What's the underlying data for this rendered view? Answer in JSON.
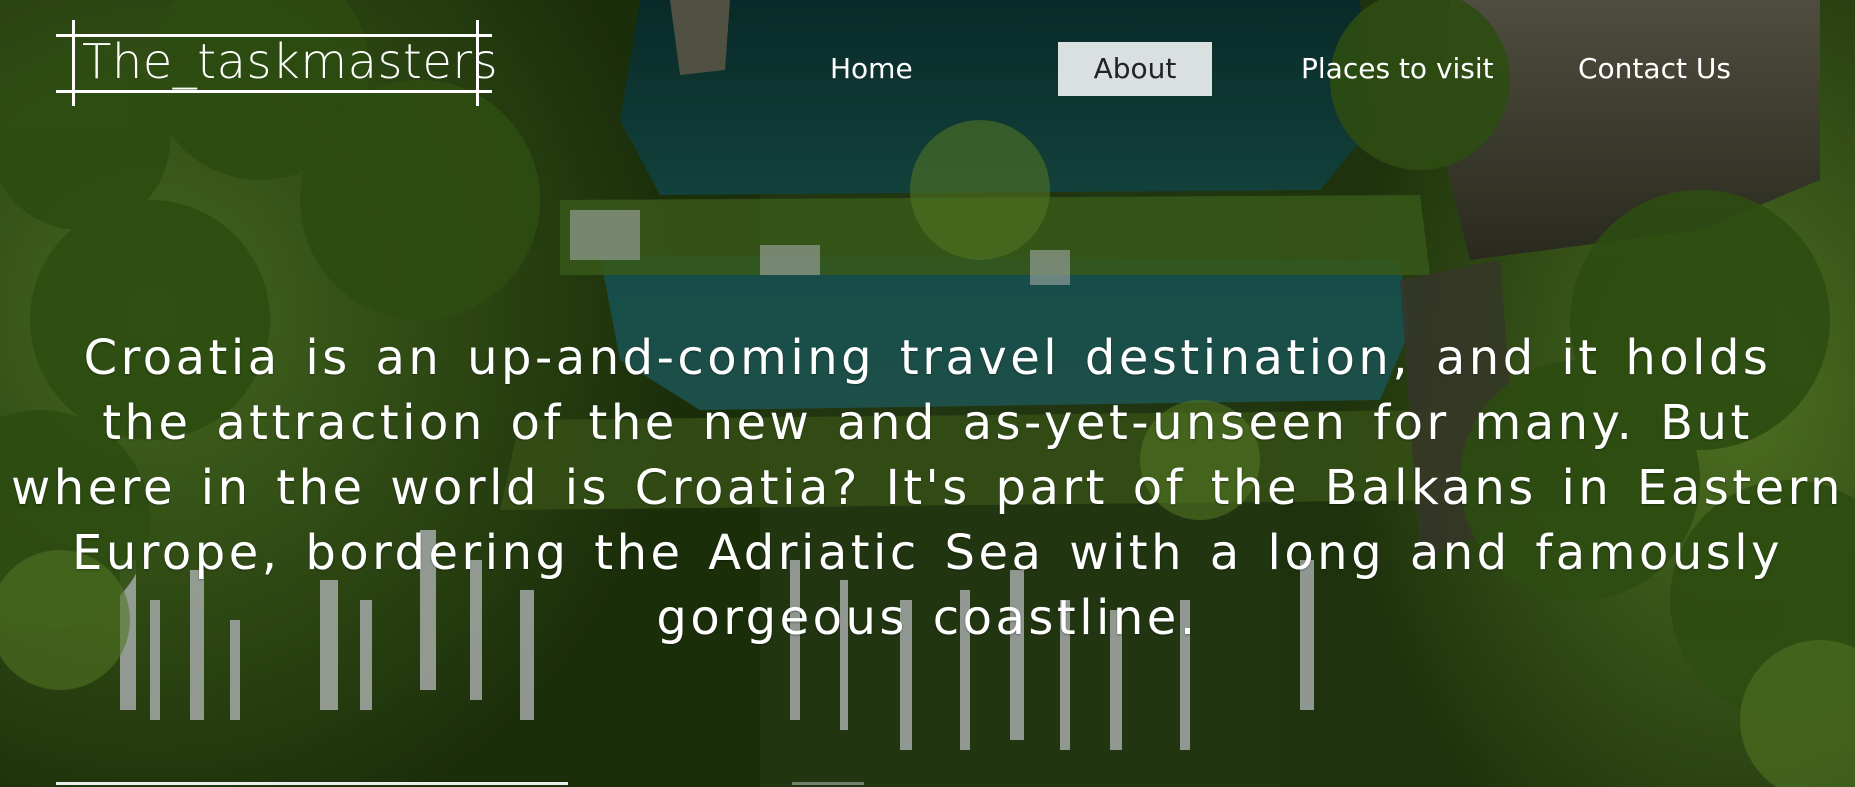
{
  "site": {
    "logo_text": "The_taskmasters"
  },
  "nav": {
    "items": [
      {
        "label": "Home"
      },
      {
        "label": "About"
      },
      {
        "label": "Places to visit"
      },
      {
        "label": "Contact Us"
      }
    ],
    "active": "About"
  },
  "hero": {
    "lines": [
      "Croatia is an up-and-coming travel destination, and it holds",
      "the attraction of the new and as-yet-unseen for many. But",
      "where in the world is Croatia? It's part of the Balkans in Eastern",
      "Europe, bordering the Adriatic Sea with a long and famously",
      "gorgeous coastline."
    ]
  },
  "colors": {
    "text": "#ffffff",
    "active_nav_bg": "#ebeef0",
    "active_nav_text": "#222222"
  }
}
